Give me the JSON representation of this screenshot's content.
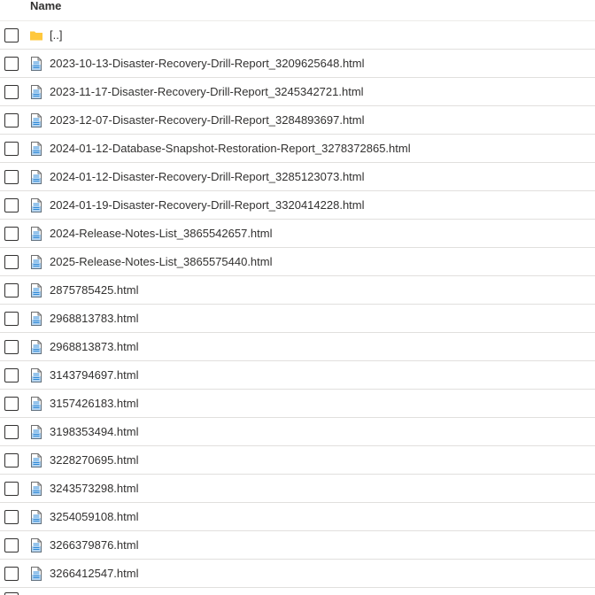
{
  "header": {
    "name_label": "Name"
  },
  "files": [
    {
      "name": "[..]",
      "type": "folder"
    },
    {
      "name": "2023-10-13-Disaster-Recovery-Drill-Report_3209625648.html",
      "type": "html"
    },
    {
      "name": "2023-11-17-Disaster-Recovery-Drill-Report_3245342721.html",
      "type": "html"
    },
    {
      "name": "2023-12-07-Disaster-Recovery-Drill-Report_3284893697.html",
      "type": "html"
    },
    {
      "name": "2024-01-12-Database-Snapshot-Restoration-Report_3278372865.html",
      "type": "html"
    },
    {
      "name": "2024-01-12-Disaster-Recovery-Drill-Report_3285123073.html",
      "type": "html"
    },
    {
      "name": "2024-01-19-Disaster-Recovery-Drill-Report_3320414228.html",
      "type": "html"
    },
    {
      "name": "2024-Release-Notes-List_3865542657.html",
      "type": "html"
    },
    {
      "name": "2025-Release-Notes-List_3865575440.html",
      "type": "html"
    },
    {
      "name": "2875785425.html",
      "type": "html"
    },
    {
      "name": "2968813783.html",
      "type": "html"
    },
    {
      "name": "2968813873.html",
      "type": "html"
    },
    {
      "name": "3143794697.html",
      "type": "html"
    },
    {
      "name": "3157426183.html",
      "type": "html"
    },
    {
      "name": "3198353494.html",
      "type": "html"
    },
    {
      "name": "3228270695.html",
      "type": "html"
    },
    {
      "name": "3243573298.html",
      "type": "html"
    },
    {
      "name": "3254059108.html",
      "type": "html"
    },
    {
      "name": "3266379876.html",
      "type": "html"
    },
    {
      "name": "3266412547.html",
      "type": "html"
    }
  ],
  "colors": {
    "folder": "#ffc83d",
    "file_accent": "#2b88d8"
  }
}
